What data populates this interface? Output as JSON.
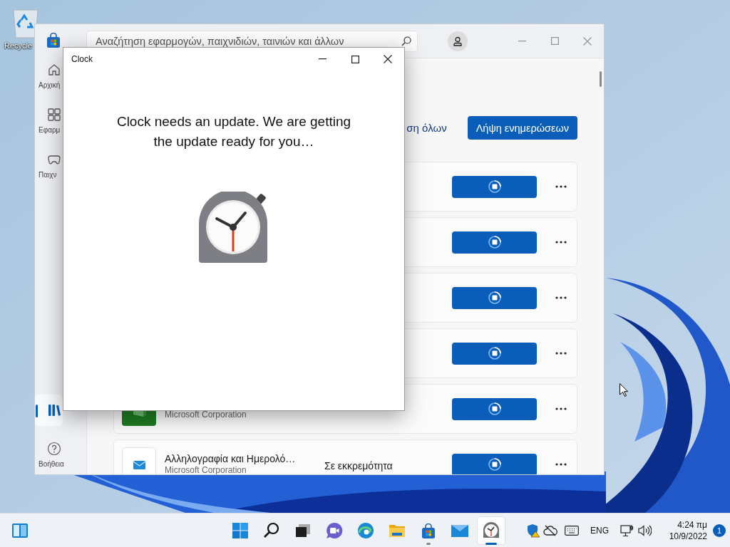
{
  "desktop": {
    "icons": [
      {
        "label": "Recycle"
      }
    ]
  },
  "store_window": {
    "nav_items": [
      {
        "kind": "home",
        "label": "Αρχική",
        "selected": false
      },
      {
        "kind": "apps",
        "label": "Εφαρμ",
        "selected": false
      },
      {
        "kind": "games",
        "label": "Παιχν",
        "selected": false
      },
      {
        "kind": "library",
        "selected": true
      },
      {
        "kind": "help",
        "label": "Βοήθεια",
        "selected": false
      }
    ],
    "search": {
      "placeholder": "Αναζήτηση εφαρμογών, παιχνιδιών, ταινιών και άλλων"
    },
    "update_all_link": "ση όλων",
    "get_updates_button": "Λήψη ενημερώσεων",
    "apps": [
      {
        "downloading": true
      },
      {
        "downloading": true
      },
      {
        "downloading": true
      },
      {
        "downloading": true
      },
      {
        "publisher": "Microsoft Corporation",
        "downloading": true
      },
      {
        "name": "Αλληλογραφία και Ημερολό…",
        "publisher": "Microsoft Corporation",
        "status": "Σε εκκρεμότητα",
        "downloading": true
      }
    ]
  },
  "clock_window": {
    "title": "Clock",
    "message": "Clock needs an update. We are getting the update ready for you…"
  },
  "taskbar": {
    "apps": [
      {
        "kind": "start",
        "running": false,
        "active": false
      },
      {
        "kind": "search",
        "running": false,
        "active": false
      },
      {
        "kind": "task-view",
        "running": false,
        "active": false
      },
      {
        "kind": "chat",
        "running": false,
        "active": false
      },
      {
        "kind": "browser",
        "running": false,
        "active": false
      },
      {
        "kind": "files",
        "running": false,
        "active": false
      },
      {
        "kind": "store",
        "running": true,
        "active": false
      },
      {
        "kind": "mail",
        "running": false,
        "active": false
      },
      {
        "kind": "clock",
        "running": true,
        "active": true
      }
    ],
    "language": "ENG",
    "time": "4:24 πμ",
    "date": "10/9/2022",
    "notification_count": "1"
  }
}
